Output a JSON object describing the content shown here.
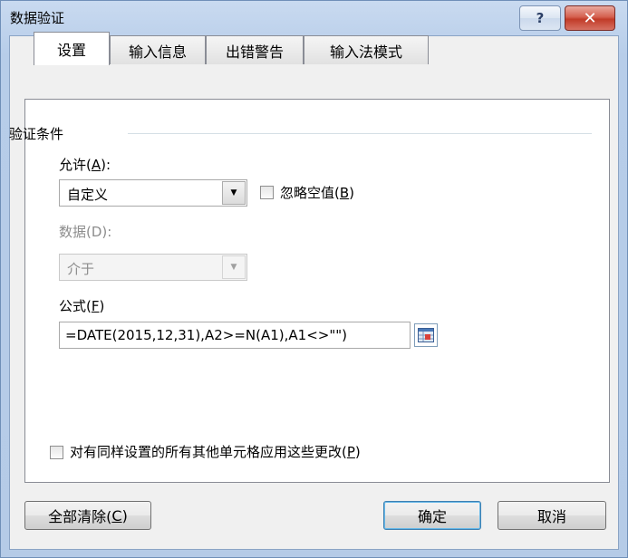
{
  "window": {
    "title": "数据验证",
    "help_label": "?",
    "close_label": "✕"
  },
  "tabs": [
    {
      "label": "设置",
      "active": true
    },
    {
      "label": "输入信息",
      "active": false
    },
    {
      "label": "出错警告",
      "active": false
    },
    {
      "label": "输入法模式",
      "active": false
    }
  ],
  "settings": {
    "group_label": "验证条件",
    "allow": {
      "label_main": "允许(",
      "label_key": "A",
      "label_end": "):",
      "value": "自定义"
    },
    "ignore_blank": {
      "label_main": "忽略空值(",
      "label_key": "B",
      "label_end": ")",
      "checked": false
    },
    "data": {
      "label": "数据(D):",
      "value": "介于",
      "disabled": true
    },
    "formula": {
      "label_main": "公式(",
      "label_key": "F",
      "label_end": ")",
      "value": "=DATE(2015,12,31),A2>=N(A1),A1<>\"\")"
    },
    "apply_all": {
      "label_main": "对有同样设置的所有其他单元格应用这些更改(",
      "label_key": "P",
      "label_end": ")",
      "checked": false
    }
  },
  "buttons": {
    "clear_all": {
      "main": "全部清除(",
      "key": "C",
      "end": ")"
    },
    "ok": "确定",
    "cancel": "取消"
  },
  "icons": {
    "dropdown": "dropdown-arrow-icon",
    "collapse": "collapse-dialog-icon"
  }
}
